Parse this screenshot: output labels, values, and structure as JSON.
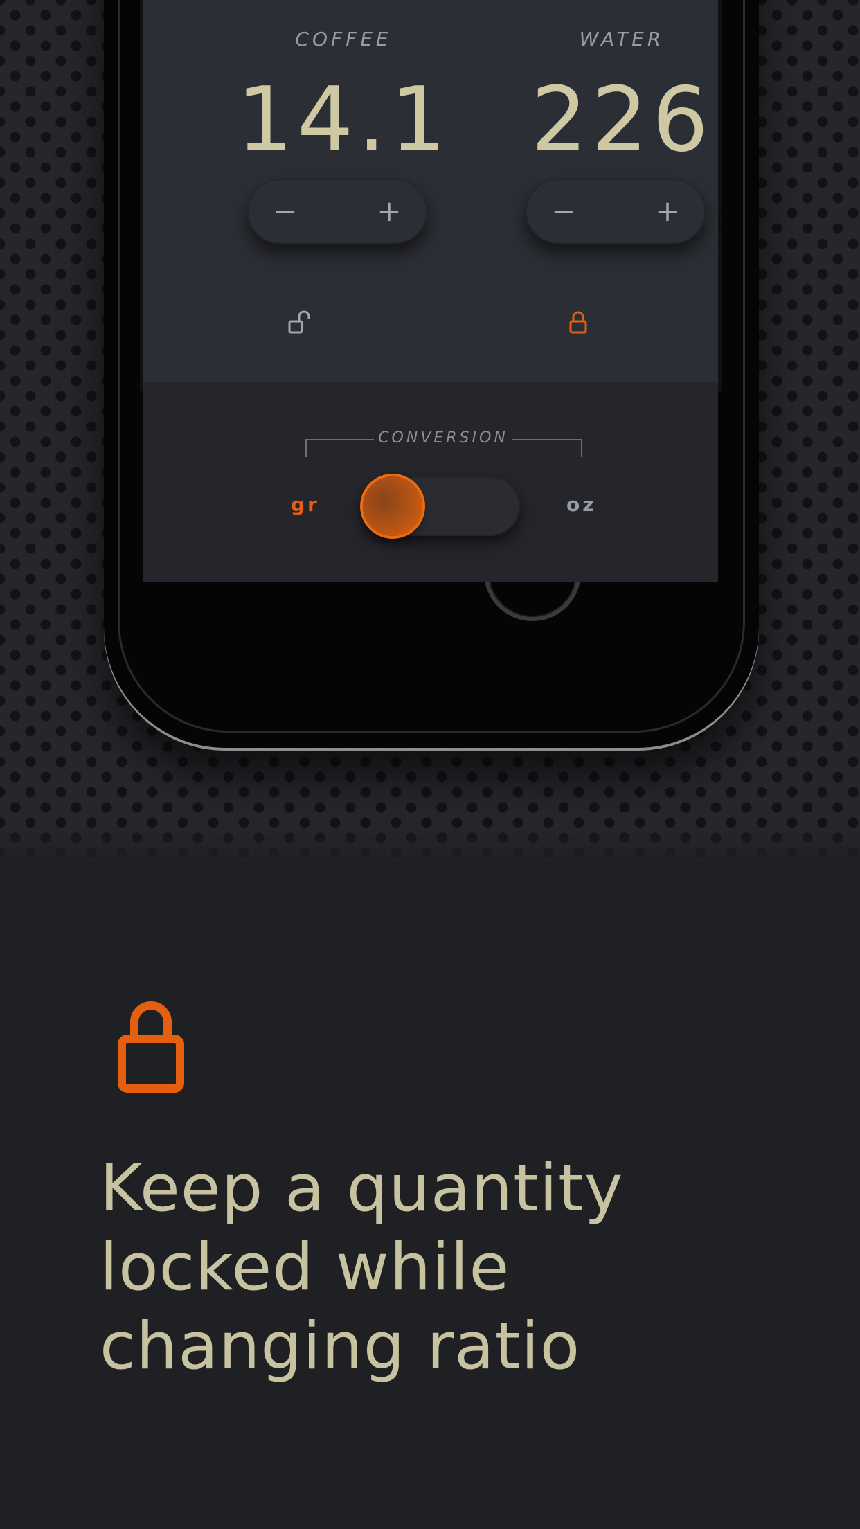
{
  "colors": {
    "accent": "#e55f10",
    "value_text": "#cfc9a3",
    "headline_text": "#c7c2a0",
    "background": "#1f2024"
  },
  "calculator": {
    "coffee": {
      "label": "COFFEE",
      "value": "14.1",
      "minus": "−",
      "plus": "+",
      "lock_icon": "unlocked-padlock-icon",
      "locked": false
    },
    "water": {
      "label": "WATER",
      "value": "226",
      "minus": "−",
      "plus": "+",
      "lock_icon": "locked-padlock-icon",
      "locked": true
    }
  },
  "conversion": {
    "label": "CONVERSION",
    "left_unit": "gr",
    "right_unit": "oz",
    "selected": "gr"
  },
  "feature": {
    "icon": "padlock-icon",
    "headline_lines": [
      "Keep a quantity",
      "locked while",
      "changing ratio"
    ]
  }
}
